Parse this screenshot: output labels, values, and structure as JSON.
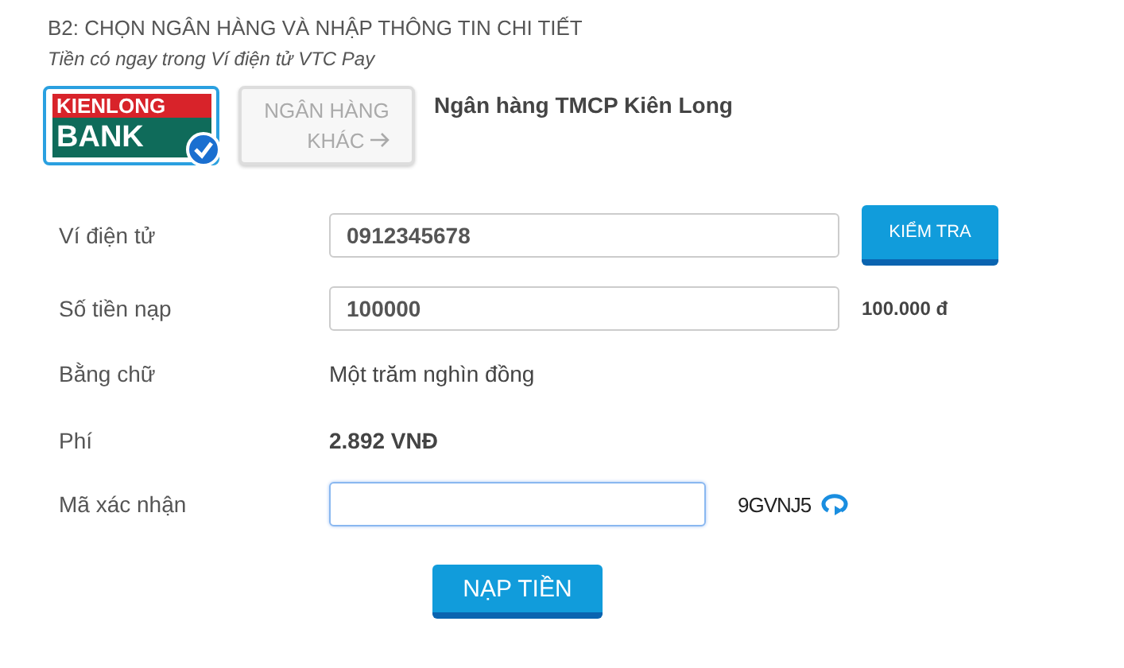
{
  "heading": "B2: CHỌN NGÂN HÀNG VÀ NHẬP THÔNG TIN CHI TIẾT",
  "subheading": "Tiền có ngay trong Ví điện tử VTC Pay",
  "banks": [
    {
      "kind": "logo",
      "line1": "KIENLONG",
      "line2": "BANK",
      "selected": true
    },
    {
      "kind": "other",
      "line1": "NGÂN HÀNG",
      "line2": "KHÁC",
      "selected": false
    }
  ],
  "bank_name": "Ngân hàng TMCP Kiên Long",
  "rows": [
    {
      "kind": "input",
      "label": "Ví điện tử",
      "value": "0912345678",
      "button": "KIỂM TRA"
    },
    {
      "kind": "input",
      "label": "Số tiền nạp",
      "value": "100000",
      "note": "100.000 đ"
    },
    {
      "kind": "text",
      "label": "Bằng chữ",
      "value": "Một trăm nghìn đồng"
    },
    {
      "kind": "bold",
      "label": "Phí",
      "value": "2.892 VNĐ"
    },
    {
      "kind": "captcha",
      "label": "Mã xác nhận",
      "value": "",
      "focused": true,
      "captcha": "9GVNJ5"
    }
  ],
  "submit": "NẠP TIỀN"
}
